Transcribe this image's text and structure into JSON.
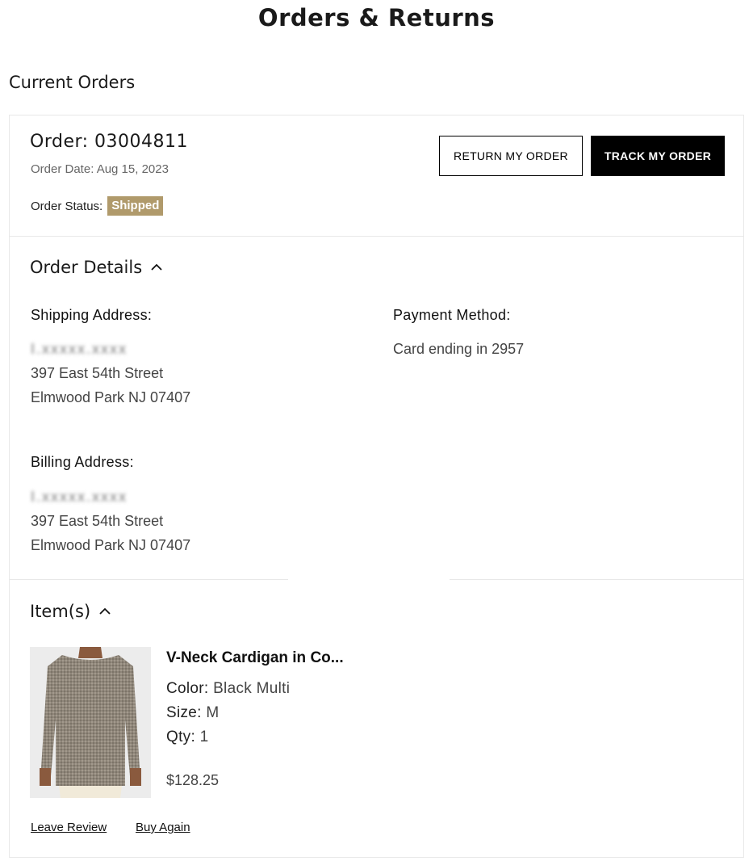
{
  "page": {
    "title": "Orders & Returns"
  },
  "current_orders": {
    "heading": "Current Orders"
  },
  "order": {
    "number_label": "Order: 03004811",
    "date_label": "Order Date: Aug 15, 2023",
    "status_label": "Order Status:",
    "status_value": "Shipped",
    "status_color": "#b09a6b",
    "return_button": "RETURN MY ORDER",
    "track_button": "TRACK MY ORDER"
  },
  "details": {
    "title": "Order Details",
    "shipping": {
      "label": "Shipping Address:",
      "name_redacted": "I.xxxxx.xxxx",
      "line1": "397 East 54th Street",
      "line2": "Elmwood Park NJ 07407"
    },
    "payment": {
      "label": "Payment Method:",
      "value": "Card ending in 2957"
    },
    "billing": {
      "label": "Billing Address:",
      "name_redacted": "I.xxxxx.xxxx",
      "line1": "397 East 54th Street",
      "line2": "Elmwood Park NJ 07407"
    }
  },
  "items": {
    "title": "Item(s)",
    "list": [
      {
        "name": "V-Neck Cardigan in Co...",
        "color_label": "Color:",
        "color_value": "Black Multi",
        "size_label": "Size:",
        "size_value": "M",
        "qty_label": "Qty:",
        "qty_value": "1",
        "price": "$128.25",
        "leave_review": "Leave Review",
        "buy_again": "Buy Again"
      }
    ]
  },
  "icons": {
    "chevron": "chevron-up-icon"
  }
}
